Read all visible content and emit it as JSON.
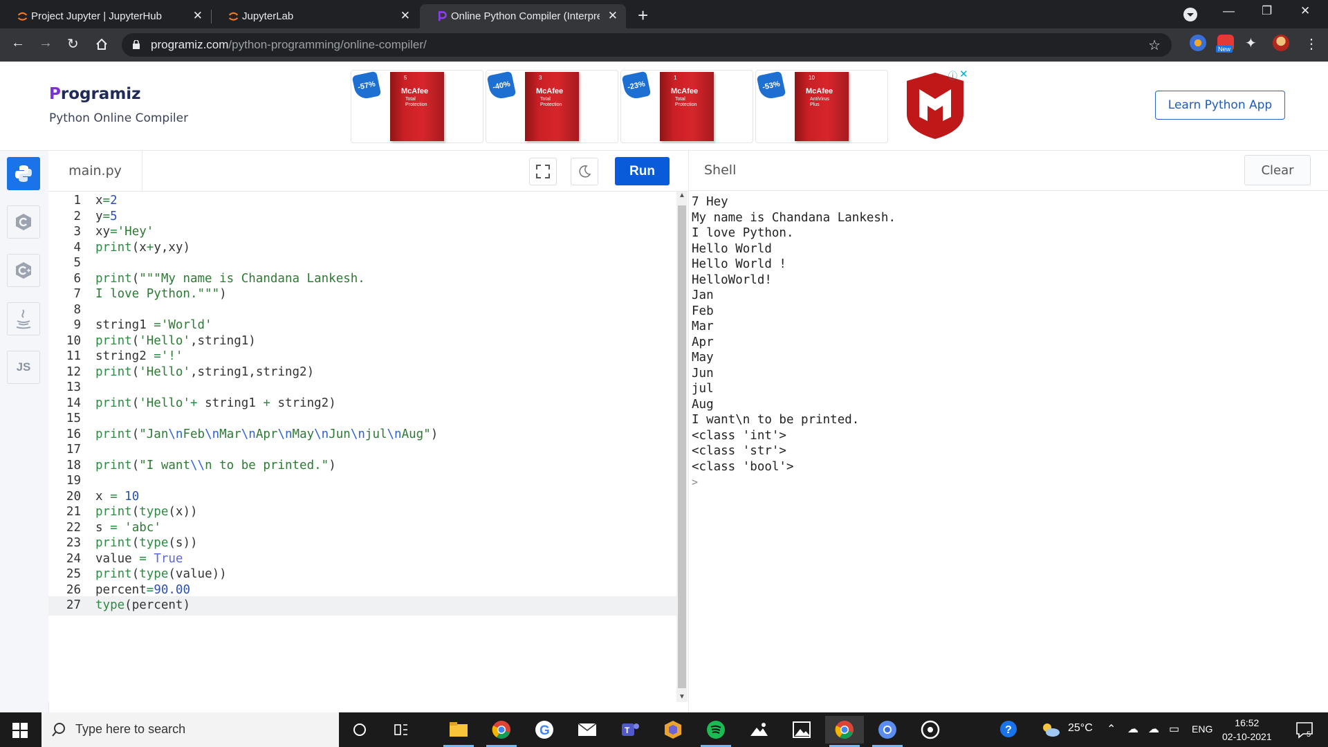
{
  "browser": {
    "tabs": [
      {
        "title": "Project Jupyter | JupyterHub",
        "active": false
      },
      {
        "title": "JupyterLab",
        "active": false
      },
      {
        "title": "Online Python Compiler (Interpre",
        "active": true
      }
    ],
    "url_host": "programiz.com",
    "url_path": "/python-programming/online-compiler/",
    "extension_badge": "New"
  },
  "site": {
    "logo": "rogramiz",
    "logo_p": "P",
    "tagline": "Python Online Compiler",
    "learn_button": "Learn Python App",
    "ad": {
      "cards": [
        {
          "badge": "-57%",
          "box_num": "5",
          "box_title": "McAfee",
          "box_sub": "Total Protection"
        },
        {
          "badge": "-40%",
          "box_num": "3",
          "box_title": "McAfee",
          "box_sub": "Total Protection"
        },
        {
          "badge": "-23%",
          "box_num": "1",
          "box_title": "McAfee",
          "box_sub": "Total Protection"
        },
        {
          "badge": "-53%",
          "box_num": "10",
          "box_title": "McAfee",
          "box_sub": "AntiVirus Plus"
        }
      ],
      "brand_color": "#c01818"
    }
  },
  "languages": {
    "js_label": "JS"
  },
  "editor": {
    "filename": "main.py",
    "run_label": "Run",
    "current_line": 27,
    "lines": [
      {
        "n": "1",
        "html": "x<span class='o'>=</span><span class='n'>2</span>"
      },
      {
        "n": "2",
        "html": "y<span class='o'>=</span><span class='n'>5</span>"
      },
      {
        "n": "3",
        "html": "xy<span class='o'>=</span><span class='s'>'Hey'</span>"
      },
      {
        "n": "4",
        "html": "<span class='k'>print</span>(x<span class='o'>+</span>y,xy)"
      },
      {
        "n": "5",
        "html": ""
      },
      {
        "n": "6",
        "html": "<span class='k'>print</span>(<span class='s'>\"\"\"My name is Chandana Lankesh.</span>"
      },
      {
        "n": "7",
        "html": "<span class='s'>I love Python.\"\"\"</span>)"
      },
      {
        "n": "8",
        "html": ""
      },
      {
        "n": "9",
        "html": "string1 <span class='o'>=</span><span class='s'>'World'</span>"
      },
      {
        "n": "10",
        "html": "<span class='k'>print</span>(<span class='s'>'Hello'</span>,string1)"
      },
      {
        "n": "11",
        "html": "string2 <span class='o'>=</span><span class='s'>'!'</span>"
      },
      {
        "n": "12",
        "html": "<span class='k'>print</span>(<span class='s'>'Hello'</span>,string1,string2)"
      },
      {
        "n": "13",
        "html": ""
      },
      {
        "n": "14",
        "html": "<span class='k'>print</span>(<span class='s'>'Hello'</span><span class='o'>+</span> string1 <span class='o'>+</span> string2)"
      },
      {
        "n": "15",
        "html": ""
      },
      {
        "n": "16",
        "html": "<span class='k'>print</span>(<span class='s'>\"Jan<span class='e'>\\n</span>Feb<span class='e'>\\n</span>Mar<span class='e'>\\n</span>Apr<span class='e'>\\n</span>May<span class='e'>\\n</span>Jun<span class='e'>\\n</span>jul<span class='e'>\\n</span>Aug\"</span>)"
      },
      {
        "n": "17",
        "html": ""
      },
      {
        "n": "18",
        "html": "<span class='k'>print</span>(<span class='s'>\"I want<span class='e'>\\\\</span>n to be printed.\"</span>)"
      },
      {
        "n": "19",
        "html": ""
      },
      {
        "n": "20",
        "html": "x <span class='o'>=</span> <span class='n'>10</span>"
      },
      {
        "n": "21",
        "html": "<span class='k'>print</span>(<span class='k'>type</span>(x))"
      },
      {
        "n": "22",
        "html": "s <span class='o'>=</span> <span class='s'>'abc'</span>"
      },
      {
        "n": "23",
        "html": "<span class='k'>print</span>(<span class='k'>type</span>(s))"
      },
      {
        "n": "24",
        "html": "value <span class='o'>=</span> <span class='b'>True</span>"
      },
      {
        "n": "25",
        "html": "<span class='k'>print</span>(<span class='k'>type</span>(value))"
      },
      {
        "n": "26",
        "html": "percent<span class='o'>=</span><span class='n'>90.00</span>"
      },
      {
        "n": "27",
        "html": "<span class='k'>type</span>(percent)"
      }
    ]
  },
  "shell": {
    "title": "Shell",
    "clear_label": "Clear",
    "output": [
      "7 Hey",
      "My name is Chandana Lankesh.",
      "I love Python.",
      "Hello World",
      "Hello World !",
      "HelloWorld!",
      "Jan",
      "Feb",
      "Mar",
      "Apr",
      "May",
      "Jun",
      "jul",
      "Aug",
      "I want\\n to be printed.",
      "<class 'int'>",
      "<class 'str'>",
      "<class 'bool'>"
    ],
    "prompt": ">"
  },
  "taskbar": {
    "search_placeholder": "Type here to search",
    "weather": "25°C",
    "language": "ENG",
    "time": "16:52",
    "date": "02-10-2021",
    "notifications": "5"
  },
  "colors": {
    "accent": "#0a5bd9",
    "string": "#2c7a33",
    "number": "#2a51b3"
  }
}
